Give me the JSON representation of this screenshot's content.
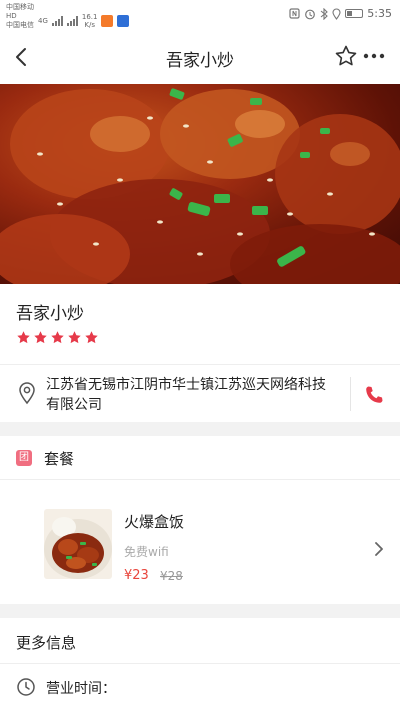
{
  "status_bar": {
    "carrier_1": "中国移动",
    "carrier_2": "中国电信",
    "net_1": "HD",
    "net_2": "HD",
    "net_type": "4G",
    "speed_value": "16.1",
    "speed_unit": "K/s",
    "time": "5:35",
    "icons": [
      "nfc-icon",
      "alarm-icon",
      "bluetooth-icon",
      "location-icon",
      "battery-icon"
    ]
  },
  "nav": {
    "title": "吾家小炒",
    "icons": [
      "back-arrow-icon",
      "star-outline-icon",
      "more-dots-icon"
    ]
  },
  "shop": {
    "name": "吾家小炒",
    "rating": 5,
    "rating_max": 5,
    "address": "江苏省无锡市江阴市华士镇江苏巡天网络科技有限公司"
  },
  "combo_section": {
    "tag": "团",
    "label": "套餐",
    "item": {
      "name": "火爆盒饭",
      "subtitle": "免费wifi",
      "price": "¥23",
      "original_price": "¥28"
    }
  },
  "more_info": {
    "label": "更多信息",
    "hours_label": "营业时间："
  },
  "colors": {
    "accent_red": "#e8453c",
    "star_red": "#e63a4a",
    "tag_pink": "#f06e80",
    "background": "#f2f2f2"
  }
}
